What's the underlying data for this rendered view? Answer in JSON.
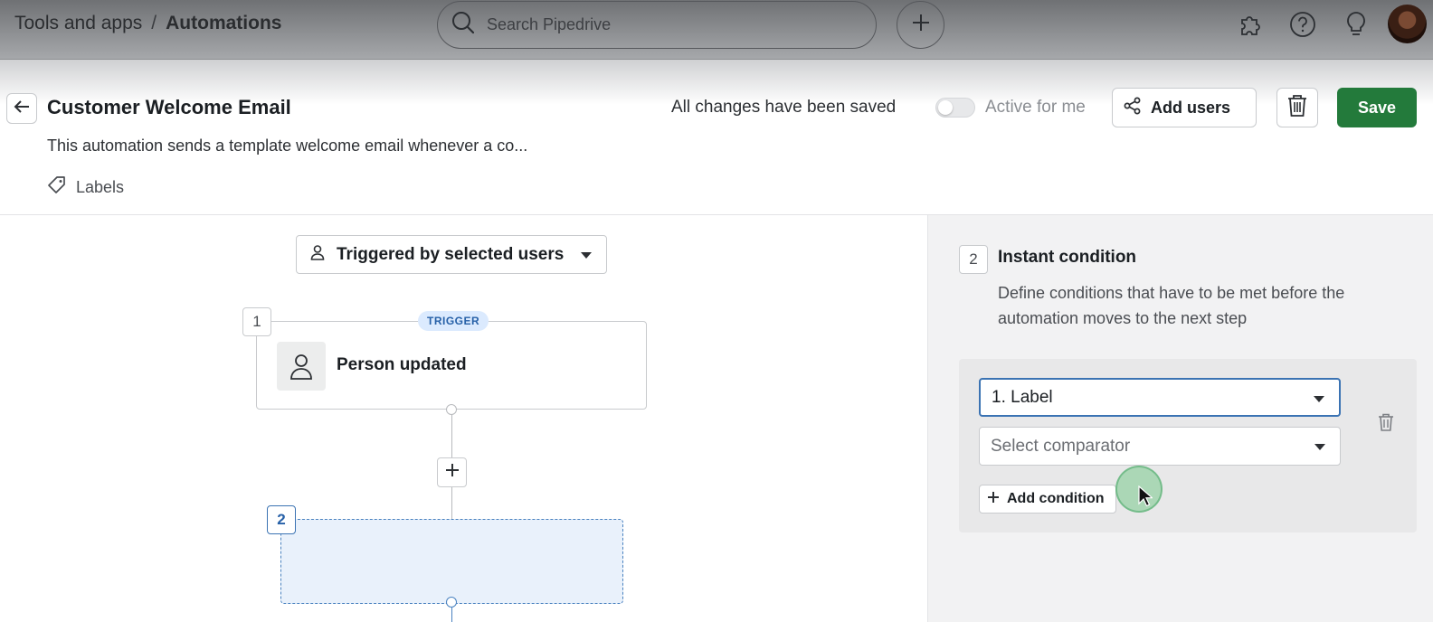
{
  "topbar": {
    "breadcrumb_parent": "Tools and apps",
    "breadcrumb_separator": "/",
    "breadcrumb_current": "Automations",
    "search_placeholder": "Search Pipedrive",
    "icons": [
      "search-icon",
      "plus-icon",
      "puzzle-icon",
      "help-icon",
      "lightbulb-icon",
      "avatar"
    ]
  },
  "header": {
    "title": "Customer Welcome Email",
    "description": "This automation sends a template welcome email whenever a co...",
    "labels_text": "Labels",
    "status_text": "All changes have been saved",
    "active_toggle_label": "Active for me",
    "active_toggle_on": false,
    "add_users_label": "Add users",
    "save_label": "Save",
    "save_color": "#237a3b"
  },
  "canvas": {
    "trigger_select_label": "Triggered by selected users",
    "steps": [
      {
        "number": "1",
        "badge": "TRIGGER",
        "label": "Person updated"
      },
      {
        "number": "2",
        "label": ""
      }
    ]
  },
  "panel": {
    "step_number": "2",
    "title": "Instant condition",
    "description": "Define conditions that have to be met before the automation moves to the next step",
    "field_select_value": "1. Label",
    "comparator_placeholder": "Select comparator",
    "add_condition_label": "Add condition"
  }
}
